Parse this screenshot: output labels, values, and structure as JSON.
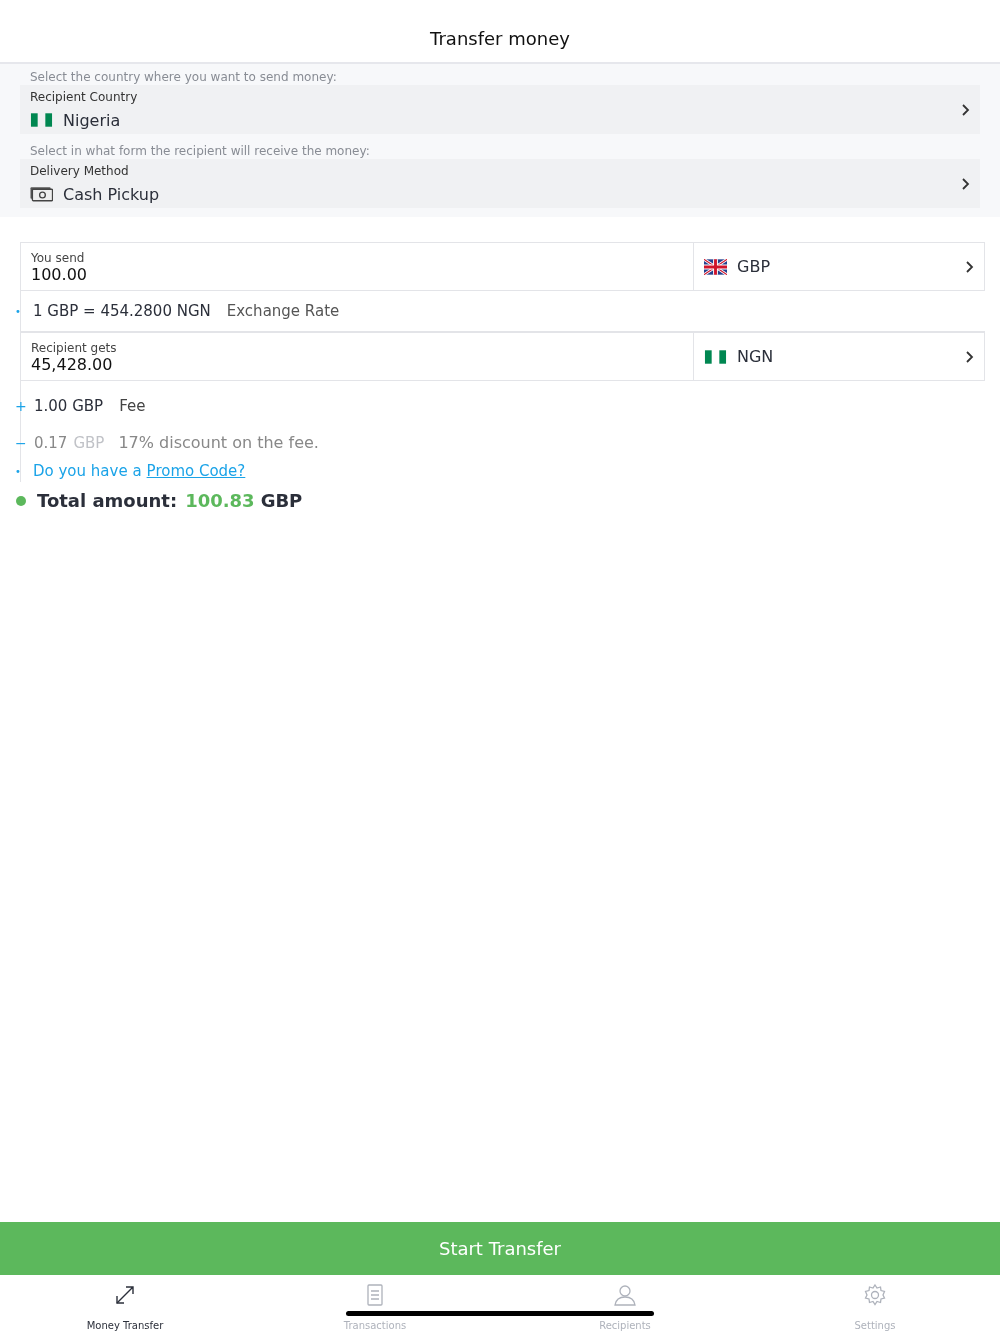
{
  "title": "Transfer money",
  "selectors": [
    {
      "hint": "Select the country where you want to send money:",
      "label": "Recipient Country",
      "value": "Nigeria",
      "kind": "flag-ng"
    },
    {
      "hint": "Select in what form the recipient will receive the money:",
      "label": "Delivery Method",
      "value": "Cash Pickup",
      "kind": "cash"
    }
  ],
  "send": {
    "label": "You send",
    "value": "100.00",
    "currency": "GBP",
    "kind": "flag-gb"
  },
  "rate": {
    "marker": "•",
    "value": "1 GBP = 454.2800 NGN",
    "label": "Exchange Rate"
  },
  "receive": {
    "label": "Recipient gets",
    "value": "45,428.00",
    "currency": "NGN",
    "kind": "flag-ng"
  },
  "fee": {
    "marker": "+",
    "amount": "1.00 GBP",
    "label": "Fee"
  },
  "discount": {
    "marker": "−",
    "amount": "0.17",
    "currency": "GBP",
    "label": "17% discount on the fee."
  },
  "promo": {
    "marker": "•",
    "text": "Do you have a",
    "link": "Promo Code?"
  },
  "total": {
    "label": "Total amount:",
    "amount": "100.83",
    "currency": "GBP"
  },
  "button": "Start Transfer",
  "tabs": [
    {
      "label": "Money Transfer",
      "kind": "transfer",
      "selected": true
    },
    {
      "label": "Transactions",
      "kind": "document",
      "selected": false
    },
    {
      "label": "Recipients",
      "kind": "person",
      "selected": false
    },
    {
      "label": "Settings",
      "kind": "gear",
      "selected": false
    }
  ]
}
